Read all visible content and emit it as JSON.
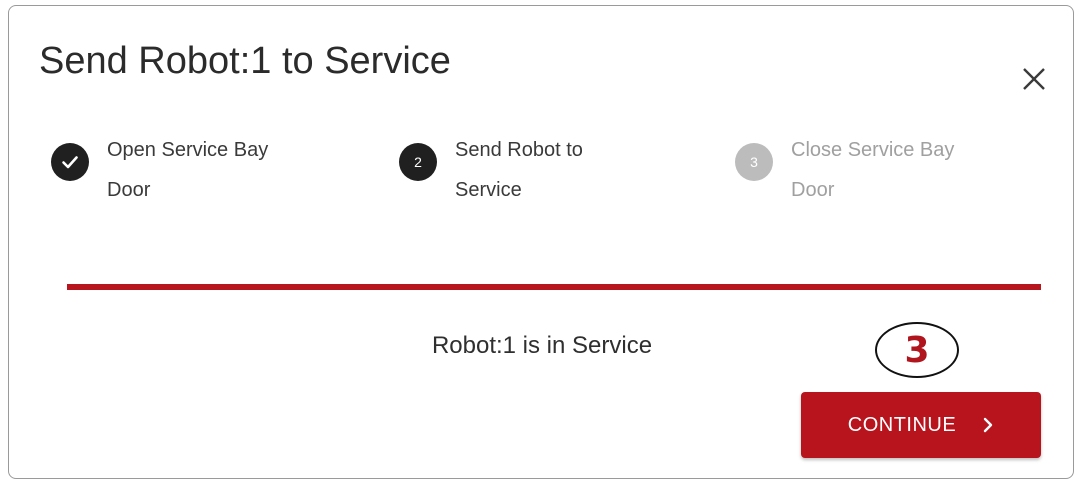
{
  "dialog": {
    "title": "Send Robot:1 to Service",
    "close_icon": "close-icon"
  },
  "steps": [
    {
      "number": "1",
      "label_line1": "Open Service Bay",
      "label_line2": "Door",
      "state": "completed",
      "icon": "check-icon"
    },
    {
      "number": "2",
      "label_line1": "Send Robot to",
      "label_line2": "Service",
      "state": "active"
    },
    {
      "number": "3",
      "label_line1": "Close Service Bay",
      "label_line2": "Door",
      "state": "pending"
    }
  ],
  "status": {
    "message": "Robot:1 is in Service"
  },
  "annotation": {
    "label": "3"
  },
  "actions": {
    "continue_label": "CONTINUE",
    "continue_icon": "chevron-right-icon"
  },
  "colors": {
    "accent": "#b8141d",
    "step_active": "#202020",
    "step_pending": "#bcbcbc"
  }
}
